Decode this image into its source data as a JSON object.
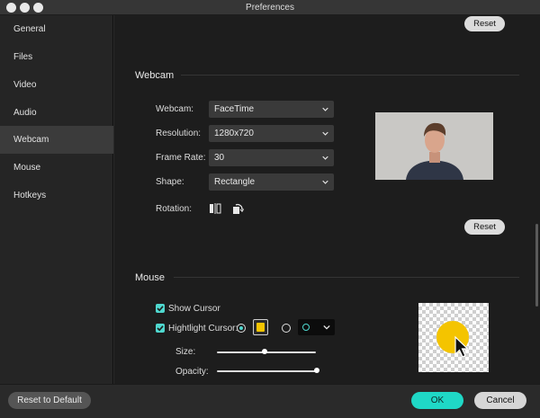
{
  "window": {
    "title": "Preferences"
  },
  "sidebar": {
    "items": [
      {
        "label": "General"
      },
      {
        "label": "Files"
      },
      {
        "label": "Video"
      },
      {
        "label": "Audio"
      },
      {
        "label": "Webcam",
        "active": true
      },
      {
        "label": "Mouse"
      },
      {
        "label": "Hotkeys"
      }
    ]
  },
  "top_section": {
    "reset_label": "Reset"
  },
  "webcam": {
    "title": "Webcam",
    "fields": {
      "webcam": {
        "label": "Webcam:",
        "value": "FaceTime"
      },
      "resolution": {
        "label": "Resolution:",
        "value": "1280x720"
      },
      "frame_rate": {
        "label": "Frame Rate:",
        "value": "30"
      },
      "shape": {
        "label": "Shape:",
        "value": "Rectangle"
      }
    },
    "rotation_label": "Rotation:",
    "rotation_icons": [
      "flip-horizontal-icon",
      "rotate-icon"
    ],
    "reset_label": "Reset"
  },
  "mouse": {
    "title": "Mouse",
    "show_cursor": {
      "label": "Show Cursor",
      "checked": true
    },
    "highlight_cursor": {
      "label": "Hightlight Cursor:",
      "checked": true,
      "fill_color": "#f4c400"
    },
    "size": {
      "label": "Size:",
      "value_fraction": 0.48
    },
    "opacity": {
      "label": "Opacity:",
      "value_fraction": 0.98
    }
  },
  "footer": {
    "reset_default_label": "Reset to Default",
    "ok_label": "OK",
    "cancel_label": "Cancel"
  },
  "colors": {
    "accent": "#4fd8cf",
    "highlight": "#f4c400"
  }
}
